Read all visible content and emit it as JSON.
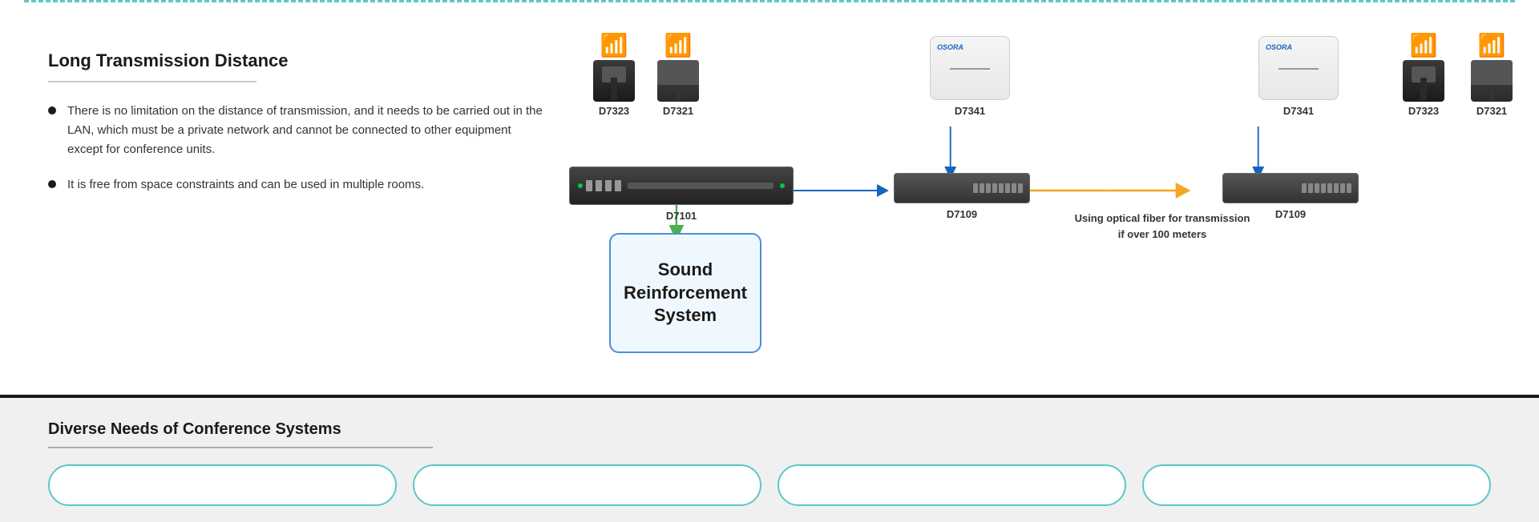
{
  "top_border": {},
  "left": {
    "title": "Long Transmission Distance",
    "bullet1": "There is no limitation on the distance of transmission, and it needs to be carried out in the LAN, which must be a private network and cannot be connected to other equipment except for conference units.",
    "bullet2": "It is free from space constraints and can be used in multiple rooms."
  },
  "diagram": {
    "devices": {
      "d7323_left": "D7323",
      "d7321_left": "D7321",
      "d7101": "D7101",
      "d7341_left": "D7341",
      "d7109_left": "D7109",
      "d7341_right": "D7341",
      "d7109_right": "D7109",
      "d7323_right": "D7323",
      "d7321_right": "D7321"
    },
    "sound_box": "Sound\nReinforcement\nSystem",
    "fiber_note": "Using optical fiber for transmission\nif over 100 meters"
  },
  "bottom": {
    "title": "Diverse Needs of Conference Systems"
  }
}
